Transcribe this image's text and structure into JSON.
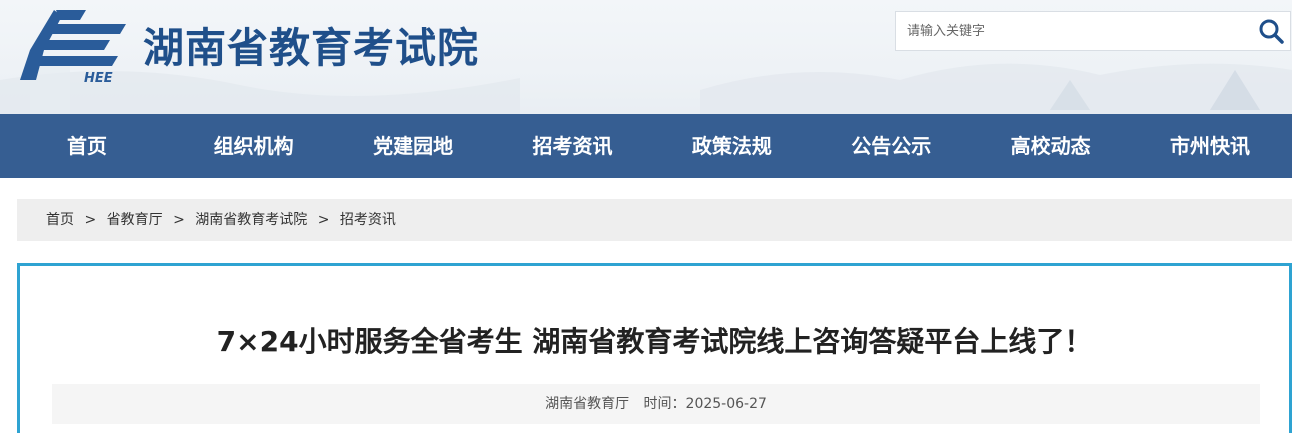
{
  "site": {
    "title": "湖南省教育考试院",
    "logo_text": "HEE"
  },
  "search": {
    "placeholder": "请输入关键字",
    "icon": "search-icon"
  },
  "nav": {
    "items": [
      {
        "label": "首页"
      },
      {
        "label": "组织机构"
      },
      {
        "label": "党建园地"
      },
      {
        "label": "招考资讯"
      },
      {
        "label": "政策法规"
      },
      {
        "label": "公告公示"
      },
      {
        "label": "高校动态"
      },
      {
        "label": "市州快讯"
      }
    ]
  },
  "breadcrumb": {
    "items": [
      "首页",
      "省教育厅",
      "湖南省教育考试院",
      "招考资讯"
    ],
    "separator": ">"
  },
  "article": {
    "title": "7×24小时服务全省考生 湖南省教育考试院线上咨询答疑平台上线了！",
    "source": "湖南省教育厅",
    "time_label": "时间：",
    "date": "2025-06-27"
  },
  "colors": {
    "brand": "#1f4f8a",
    "nav_bg": "#365e92",
    "article_border": "#2ea3d2"
  }
}
